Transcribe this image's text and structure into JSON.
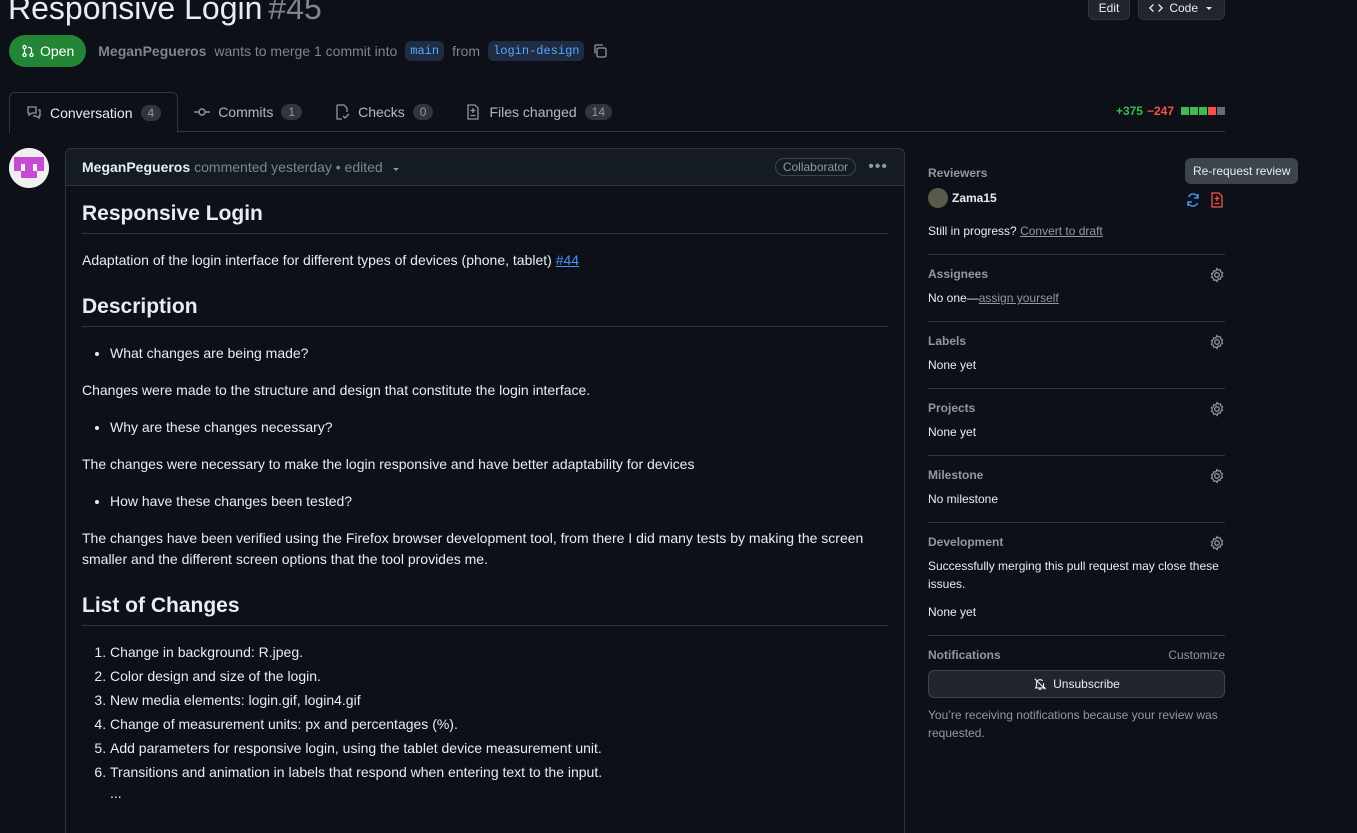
{
  "header": {
    "title": "Responsive Login",
    "number": "#45",
    "edit_label": "Edit",
    "code_label": "Code",
    "state": "Open",
    "author": "MeganPegueros",
    "merge_text": "wants to merge 1 commit into",
    "base_branch": "main",
    "from_text": "from",
    "head_branch": "login-design"
  },
  "tabs": [
    {
      "label": "Conversation",
      "count": "4"
    },
    {
      "label": "Commits",
      "count": "1"
    },
    {
      "label": "Checks",
      "count": "0"
    },
    {
      "label": "Files changed",
      "count": "14"
    }
  ],
  "diffstat": {
    "additions": "+375",
    "deletions": "−247"
  },
  "comment": {
    "author": "MeganPegueros",
    "meta": "commented yesterday • edited",
    "badge": "Collaborator",
    "h1": "Responsive Login",
    "intro": "Adaptation of the login interface for different types of devices (phone, tablet)",
    "intro_link": "#44",
    "h_description": "Description",
    "q1": "What changes are being made?",
    "a1": "Changes were made to the structure and design that constitute the login interface.",
    "q2": "Why are these changes necessary?",
    "a2": "The changes were necessary to make the login responsive and have better adaptability for devices",
    "q3": "How have these changes been tested?",
    "a3": "The changes have been verified using the Firefox browser development tool, from there I did many tests by making the screen smaller and the different screen options that the tool provides me.",
    "h_changes": "List of Changes",
    "changes": [
      "Change in background: R.jpeg.",
      "Color design and size of the login.",
      "New media elements: login.gif, login4.gif",
      "Change of measurement units: px and percentages (%).",
      "Add parameters for responsive login, using the tablet device measurement unit.",
      "Transitions and animation in labels that respond when entering text to the input."
    ],
    "ellipsis": "..."
  },
  "sidebar": {
    "reviewers_title": "Reviewers",
    "reviewer_name": "Zama15",
    "tooltip": "Re-request review",
    "progress_text": "Still in progress?",
    "draft_link": "Convert to draft",
    "assignees_title": "Assignees",
    "assignees_text": "No one—",
    "assign_link": "assign yourself",
    "labels_title": "Labels",
    "labels_text": "None yet",
    "projects_title": "Projects",
    "projects_text": "None yet",
    "milestone_title": "Milestone",
    "milestone_text": "No milestone",
    "development_title": "Development",
    "development_text": "Successfully merging this pull request may close these issues.",
    "development_none": "None yet",
    "notifications_title": "Notifications",
    "customize": "Customize",
    "unsubscribe": "Unsubscribe",
    "notif_reason": "You’re receiving notifications because your review was requested."
  },
  "colors": {
    "accent_green": "#238636",
    "additions": "#3fb950",
    "deletions": "#f85149",
    "link": "#4493f8"
  }
}
